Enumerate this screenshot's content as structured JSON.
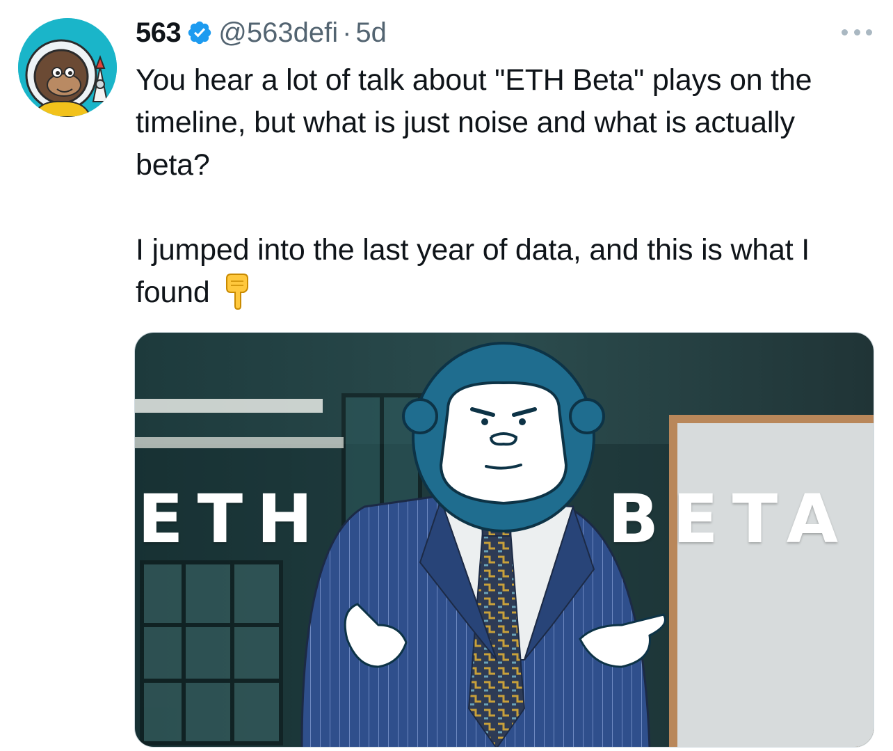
{
  "tweet": {
    "display_name": "563",
    "handle": "@563defi",
    "separator": "·",
    "time": "5d",
    "paragraph_1": "You hear a lot of talk about \"ETH Beta\" plays on the timeline, but what is just noise and what is actually beta?",
    "paragraph_2": "I jumped into the last year of data, and this is what I found",
    "emoji": "backhand-index-pointing-down"
  },
  "media": {
    "overlay_left": "ETH",
    "overlay_right": "BETA"
  },
  "colors": {
    "verified": "#1d9bf0",
    "secondary_text": "#536471",
    "avatar_bg": "#1ab5c9",
    "gorilla": "#1f6d8f",
    "suit": "#2f4f8c"
  },
  "icons": {
    "verified": "verified-badge-icon",
    "more": "more-options-icon",
    "hand": "pointing-down-hand-icon"
  }
}
